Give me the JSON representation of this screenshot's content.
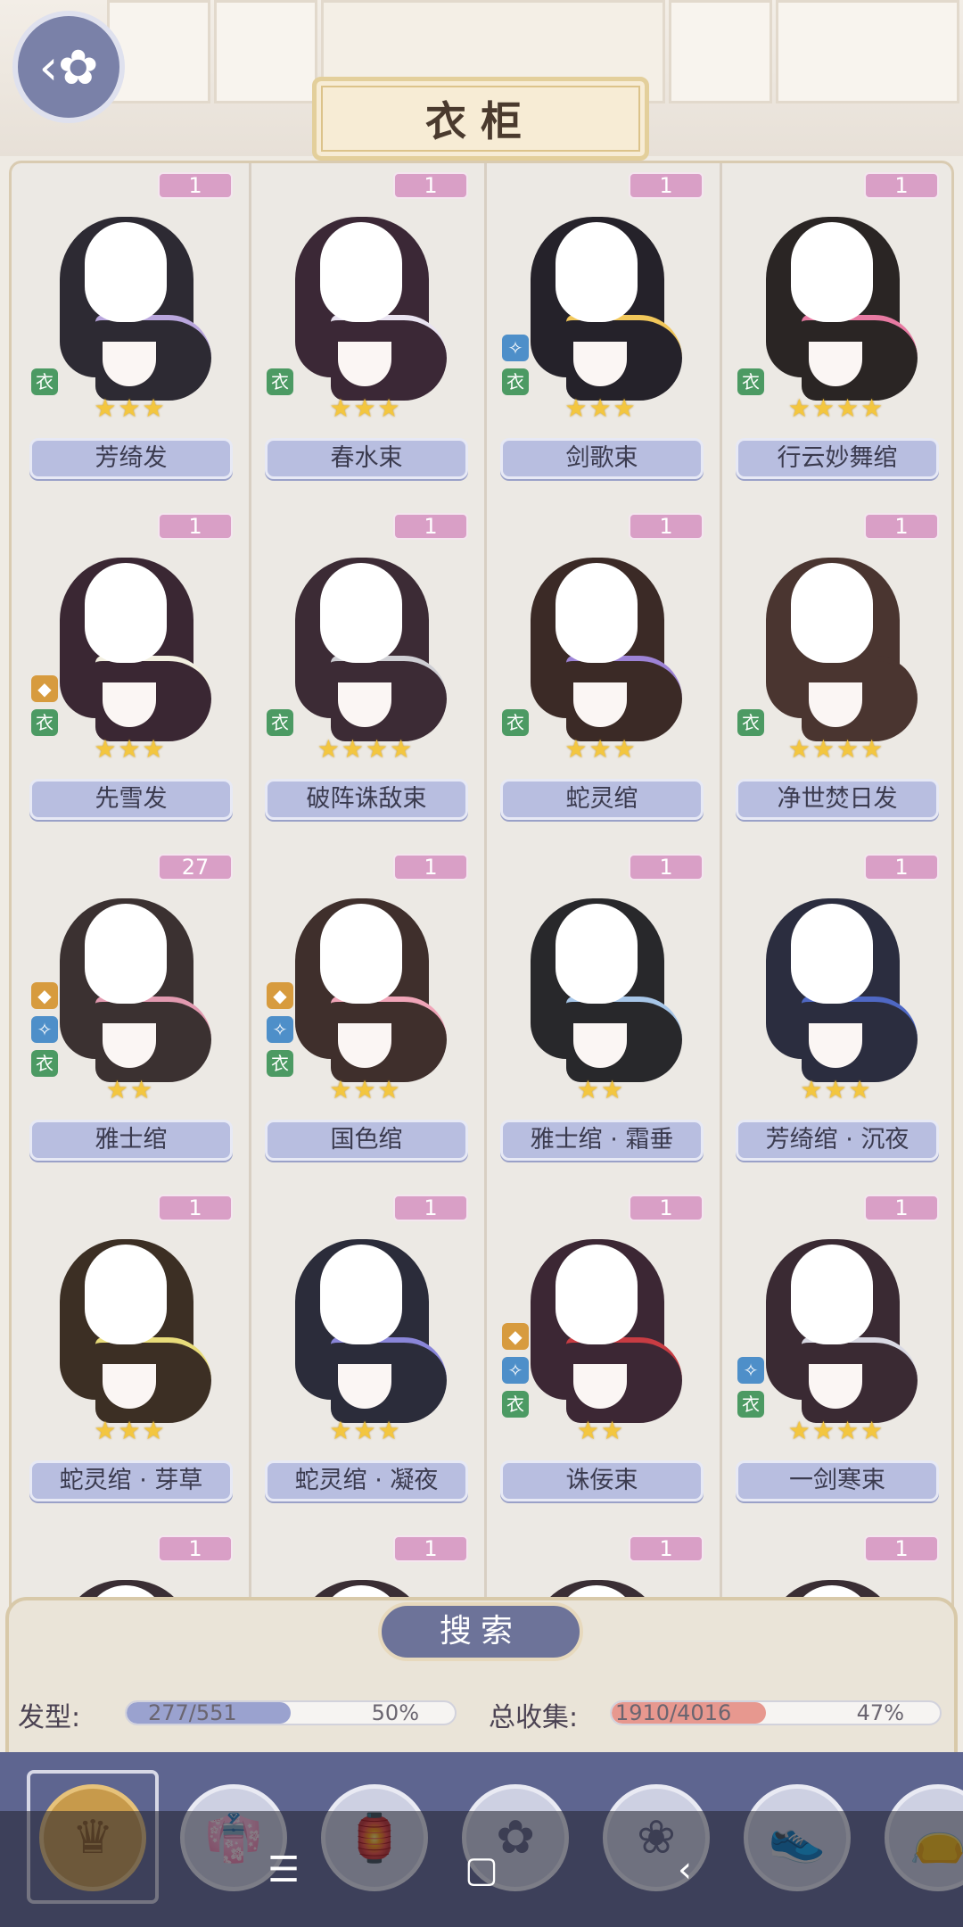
{
  "header": {
    "title": "衣柜"
  },
  "items": [
    {
      "count": "1",
      "name": "芳绮发",
      "stars": "★★★",
      "badges": [
        "green"
      ],
      "hair": "#2d2a33",
      "accent": "#b9a6dd"
    },
    {
      "count": "1",
      "name": "春水束",
      "stars": "★★★",
      "badges": [
        "green"
      ],
      "hair": "#3b2836",
      "accent": "#e9e3f1"
    },
    {
      "count": "1",
      "name": "剑歌束",
      "stars": "★★★",
      "badges": [
        "blue",
        "green"
      ],
      "hair": "#25222a",
      "accent": "#f1c75a"
    },
    {
      "count": "1",
      "name": "行云妙舞绾",
      "stars": "★★★★",
      "badges": [
        "green"
      ],
      "hair": "#2a2524",
      "accent": "#e77aa2"
    },
    {
      "count": "1",
      "name": "先雪发",
      "stars": "★★★",
      "badges": [
        "gold",
        "green"
      ],
      "hair": "#3a2733",
      "accent": "#f2efe0"
    },
    {
      "count": "1",
      "name": "破阵诛敌束",
      "stars": "★★★★",
      "badges": [
        "green"
      ],
      "hair": "#3c2b35",
      "accent": "#cfcfd4"
    },
    {
      "count": "1",
      "name": "蛇灵绾",
      "stars": "★★★",
      "badges": [
        "green"
      ],
      "hair": "#3b2a26",
      "accent": "#9d83d6"
    },
    {
      "count": "1",
      "name": "净世焚日发",
      "stars": "★★★★",
      "badges": [
        "green"
      ],
      "hair": "#4a3530",
      "accent": "#4a3530"
    },
    {
      "count": "27",
      "name": "雅士绾",
      "stars": "★★",
      "badges": [
        "gold",
        "blue",
        "green"
      ],
      "hair": "#3b3131",
      "accent": "#e29ab0"
    },
    {
      "count": "1",
      "name": "国色绾",
      "stars": "★★★",
      "badges": [
        "gold",
        "blue",
        "green"
      ],
      "hair": "#3f2f2c",
      "accent": "#f0a5b8"
    },
    {
      "count": "1",
      "name": "雅士绾 · 霜垂",
      "stars": "★★",
      "badges": [],
      "hair": "#28282b",
      "accent": "#a7c6e8"
    },
    {
      "count": "1",
      "name": "芳绮绾 · 沉夜",
      "stars": "★★★",
      "badges": [],
      "hair": "#2b2d3f",
      "accent": "#4f68c4"
    },
    {
      "count": "1",
      "name": "蛇灵绾 · 芽草",
      "stars": "★★★",
      "badges": [],
      "hair": "#3c2f24",
      "accent": "#e8dc7a"
    },
    {
      "count": "1",
      "name": "蛇灵绾 · 凝夜",
      "stars": "★★★",
      "badges": [],
      "hair": "#2b2c3a",
      "accent": "#8a86d9"
    },
    {
      "count": "1",
      "name": "诛佞束",
      "stars": "★★",
      "badges": [
        "gold",
        "blue",
        "green"
      ],
      "hair": "#3c2734",
      "accent": "#c83c43"
    },
    {
      "count": "1",
      "name": "一剑寒束",
      "stars": "★★★★",
      "badges": [
        "blue",
        "green"
      ],
      "hair": "#3a2a33",
      "accent": "#d9d9e3"
    },
    {
      "count": "1",
      "name": "",
      "stars": "",
      "badges": [],
      "hair": "#3a2e34",
      "accent": "#d9d9e3"
    },
    {
      "count": "1",
      "name": "",
      "stars": "",
      "badges": [],
      "hair": "#3a2e34",
      "accent": "#d9d9e3"
    },
    {
      "count": "1",
      "name": "",
      "stars": "",
      "badges": [],
      "hair": "#3a2e34",
      "accent": "#d9d9e3"
    },
    {
      "count": "1",
      "name": "",
      "stars": "",
      "badges": [],
      "hair": "#3a2e34",
      "accent": "#d9d9e3"
    }
  ],
  "search": {
    "label": "搜索"
  },
  "stats": {
    "hair_label": "发型:",
    "hair_value": "277/551",
    "hair_pct": "50%",
    "hair_fraction": 0.5,
    "total_label": "总收集:",
    "total_value": "1910/4016",
    "total_pct": "47%",
    "total_fraction": 0.47
  },
  "colors": {
    "badge_green": "#4c9a63",
    "badge_blue": "#4e8fc9",
    "badge_gold": "#d79b3e",
    "hair_bar": "#9aa2cf",
    "total_bar": "#e7988f"
  },
  "tabs": [
    {
      "icon": "hair-icon",
      "glyph": "♛",
      "active": true
    },
    {
      "icon": "dress-icon",
      "glyph": "👘",
      "active": false
    },
    {
      "icon": "robe-icon",
      "glyph": "🏮",
      "active": false
    },
    {
      "icon": "flower-accessory-icon",
      "glyph": "✿",
      "active": false
    },
    {
      "icon": "pendant-icon",
      "glyph": "❀",
      "active": false
    },
    {
      "icon": "shoes-icon",
      "glyph": "👟",
      "active": false
    },
    {
      "icon": "bag-icon",
      "glyph": "👝",
      "active": false
    }
  ],
  "android_nav": {
    "menu": "☰",
    "home": "▢",
    "back": "‹"
  }
}
